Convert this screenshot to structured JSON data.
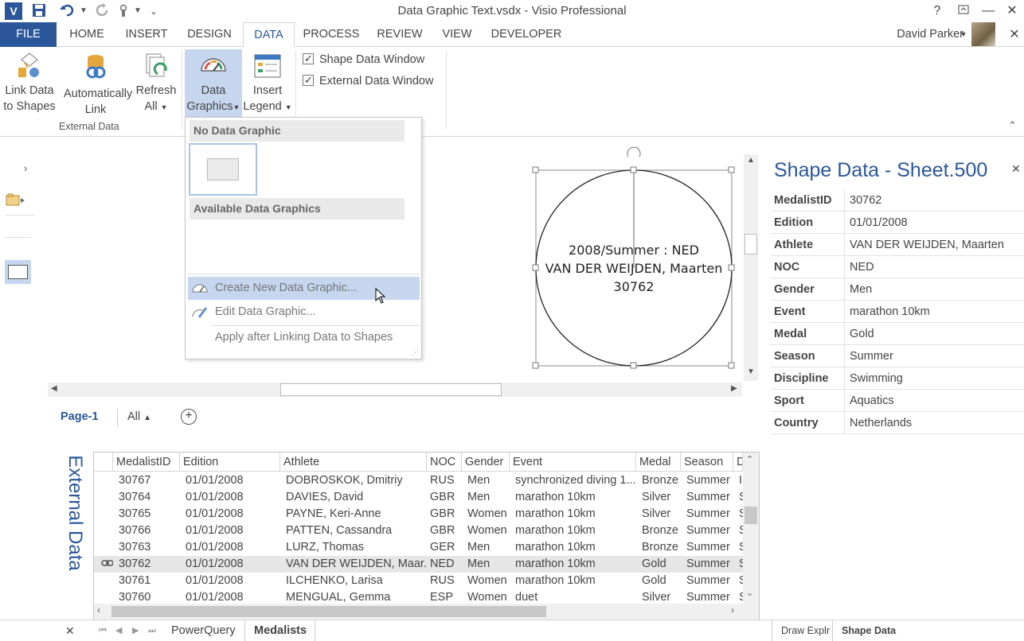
{
  "window": {
    "title": "Data Graphic Text.vsdx - Visio Professional",
    "help": "?",
    "user": "David Parker"
  },
  "tabs": [
    "FILE",
    "HOME",
    "INSERT",
    "DESIGN",
    "DATA",
    "PROCESS",
    "REVIEW",
    "VIEW",
    "DEVELOPER"
  ],
  "active_tab": "DATA",
  "ribbon": {
    "link_data": [
      "Link Data",
      "to Shapes"
    ],
    "auto_link": [
      "Automatically",
      "Link"
    ],
    "refresh_all": [
      "Refresh",
      "All"
    ],
    "external_data_group": "External Data",
    "data_graphics": [
      "Data",
      "Graphics"
    ],
    "insert_legend": [
      "Insert",
      "Legend"
    ],
    "shape_data_window": "Shape Data Window",
    "external_data_window": "External Data Window",
    "shape_data_window_checked": true,
    "external_data_window_checked": true
  },
  "dropdown": {
    "no_data_graphic": "No Data Graphic",
    "available": "Available Data Graphics",
    "create_new": "Create New Data Graphic...",
    "edit": "Edit Data Graphic...",
    "apply_after": "Apply after Linking Data to Shapes"
  },
  "shape": {
    "line1": "2008/Summer : NED",
    "line2": "VAN DER WEIJDEN, Maarten",
    "line3": "30762"
  },
  "shape_data": {
    "title": "Shape Data - Sheet.500",
    "rows": [
      {
        "k": "MedalistID",
        "v": "30762"
      },
      {
        "k": "Edition",
        "v": "01/01/2008"
      },
      {
        "k": "Athlete",
        "v": "VAN DER WEIJDEN, Maarten"
      },
      {
        "k": "NOC",
        "v": "NED"
      },
      {
        "k": "Gender",
        "v": "Men"
      },
      {
        "k": "Event",
        "v": "marathon 10km"
      },
      {
        "k": "Medal",
        "v": "Gold"
      },
      {
        "k": "Season",
        "v": "Summer"
      },
      {
        "k": "Discipline",
        "v": "Swimming"
      },
      {
        "k": "Sport",
        "v": "Aquatics"
      },
      {
        "k": "Country",
        "v": "Netherlands"
      }
    ]
  },
  "page_tabs": {
    "page1": "Page-1",
    "all": "All",
    "add": "+"
  },
  "external_data": {
    "label": "External Data",
    "columns": [
      "MedalistID",
      "Edition",
      "Athlete",
      "NOC",
      "Gender",
      "Event",
      "Medal",
      "Season",
      "D"
    ],
    "rows": [
      [
        "30767",
        "01/01/2008",
        "DOBROSKOK, Dmitriy",
        "RUS",
        "Men",
        "synchronized diving 1...",
        "Bronze",
        "Summer",
        "I"
      ],
      [
        "30764",
        "01/01/2008",
        "DAVIES, David",
        "GBR",
        "Men",
        "marathon 10km",
        "Silver",
        "Summer",
        "S"
      ],
      [
        "30765",
        "01/01/2008",
        "PAYNE, Keri-Anne",
        "GBR",
        "Women",
        "marathon 10km",
        "Silver",
        "Summer",
        "S"
      ],
      [
        "30766",
        "01/01/2008",
        "PATTEN, Cassandra",
        "GBR",
        "Women",
        "marathon 10km",
        "Bronze",
        "Summer",
        "S"
      ],
      [
        "30763",
        "01/01/2008",
        "LURZ, Thomas",
        "GER",
        "Men",
        "marathon 10km",
        "Bronze",
        "Summer",
        "S"
      ],
      [
        "30762",
        "01/01/2008",
        "VAN DER WEIJDEN, Maar...",
        "NED",
        "Men",
        "marathon 10km",
        "Gold",
        "Summer",
        "S"
      ],
      [
        "30761",
        "01/01/2008",
        "ILCHENKO, Larisa",
        "RUS",
        "Women",
        "marathon 10km",
        "Gold",
        "Summer",
        "S"
      ],
      [
        "30760",
        "01/01/2008",
        "MENGUAL, Gemma",
        "ESP",
        "Women",
        "duet",
        "Silver",
        "Summer",
        "S"
      ]
    ],
    "selected_index": 5
  },
  "sheet_tabs": {
    "powerquery": "PowerQuery",
    "medalists": "Medalists",
    "draw_explr": "Draw Explr",
    "shape_data": "Shape Data"
  },
  "colors": {
    "accent": "#2b579a",
    "highlight": "#c5d6ee"
  }
}
